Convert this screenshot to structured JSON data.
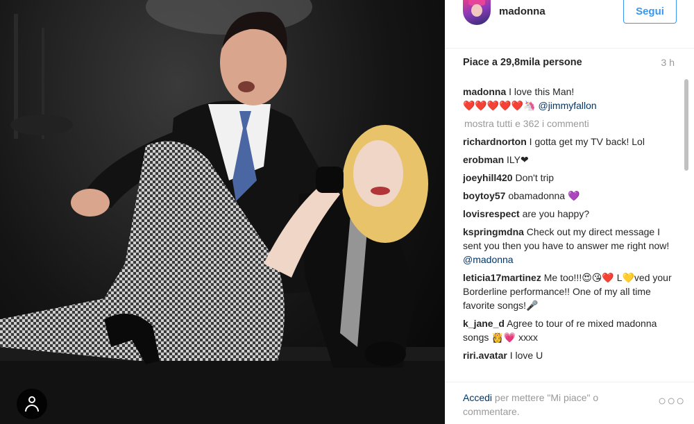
{
  "post": {
    "username": "madonna",
    "follow_label": "Segui",
    "likes_text": "Piace a 29,8mila persone",
    "time_ago": "3 h",
    "caption": {
      "author": "madonna",
      "text": "I love this Man!",
      "line2": "❤️❤️❤️❤️❤️🦄",
      "mention": "@jimmyfallon"
    },
    "show_all_text": "mostra tutti e 362 i commenti",
    "comments": [
      {
        "author": "richardnorton",
        "text": "I gotta get my TV back! Lol"
      },
      {
        "author": "erobman",
        "text": "ILY❤"
      },
      {
        "author": "joeyhill420",
        "text": "Don't trip"
      },
      {
        "author": "boytoy57",
        "text": "obamadonna 💜"
      },
      {
        "author": "lovisrespect",
        "text": "are you happy?"
      },
      {
        "author": "kspringmdna",
        "text": "Check out my direct message I sent you then you have to answer me right now!",
        "mention": "@madonna"
      },
      {
        "author": "leticia17martinez",
        "text": "Me too!!!😍😘❤️ L💛ved your Borderline performance!! One of my all time favorite songs!🎤"
      },
      {
        "author": "k_jane_d",
        "text": "Agree to tour of re mixed madonna songs 👸💗 xxxx"
      },
      {
        "author": "riri.avatar",
        "text": "I love U"
      }
    ],
    "footer": {
      "login_link": "Accedi",
      "login_rest": "per mettere \"Mi piace\" o commentare.",
      "more_dots": "○○○"
    }
  },
  "colors": {
    "accent": "#3897f0",
    "link": "#003569",
    "muted": "#999999",
    "text": "#262626"
  },
  "icons": {
    "user_tag": "user-tag-icon",
    "more": "more-options-icon"
  }
}
